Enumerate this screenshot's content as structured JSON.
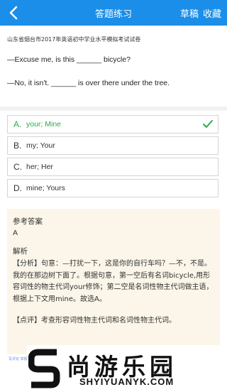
{
  "header": {
    "title": "答题练习",
    "draft_label": "草稿",
    "favorite_label": "收藏"
  },
  "question": {
    "source": "山东省烟台市2017年英语初中学业水平模拟考试试卷",
    "line1": "—Excuse me, is this ______ bicycle?",
    "line2": "—No, it isn't. ______ is over there under the tree."
  },
  "options": [
    {
      "letter": "A.",
      "text": "your; Mine",
      "state": "correct"
    },
    {
      "letter": "B.",
      "text": "my; Your",
      "state": "normal"
    },
    {
      "letter": "C.",
      "text": "her; Her",
      "state": "normal"
    },
    {
      "letter": "D.",
      "text": "mine; Yours",
      "state": "normal"
    }
  ],
  "answer": {
    "ref_title": "参考答案",
    "ref_answer": "A",
    "explanation_title": "解析",
    "analysis": "【分析】句意：—打扰一下，这是你的自行车吗？—不，不是。我的在那边树下面了。根据句意，第一空后有名词bicycle,用形容词性的物主代词your修饰；第二空是名词性物主代词做主语，根据上下文用mine。故选A。",
    "comment": "【点评】考查形容词性物主代词和名词性物主代词。"
  },
  "tiny_note": "写评论 举报 纠错",
  "watermark": {
    "cn": "尚游乐园",
    "en": "SHYIYUANYK.COM"
  },
  "colors": {
    "header_bg": "#1a8ee8",
    "correct": "#2bab4d",
    "answer_bg": "#fbf6e9"
  },
  "icons": {
    "back": "chevron-left-icon",
    "check": "check-icon",
    "logo": "s-logo-icon"
  }
}
